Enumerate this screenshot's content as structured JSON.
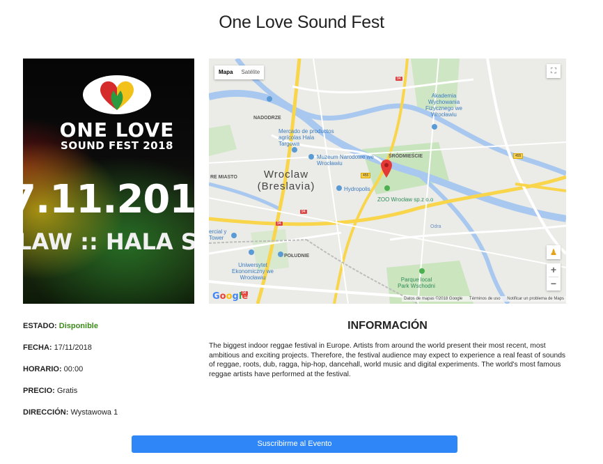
{
  "page": {
    "title": "One Love Sound Fest"
  },
  "poster": {
    "line1": "ONE LOVE",
    "line2": "SOUND FEST 2018",
    "date_fragment": "7.11.201",
    "place_fragment": "LAW :: HALA ST"
  },
  "map": {
    "type_map": "Mapa",
    "type_satellite": "Satélite",
    "labels": {
      "nadodrze": "NADODRZE",
      "mercado": "Mercado de productos agrícolas Hala Targowa",
      "muzeum": "Muzeum Narodowe we Wrocławiu",
      "akademia": "Akademia Wychowania Fizycznego we Wrocławiu",
      "srodmiescie": "ŚRÓDMIEŚCIE",
      "wroclaw": "Wroclaw (Breslavia)",
      "hydropolis": "Hydropolis",
      "zoo": "ZOO Wrocław sp.z o.o",
      "stare_miasto": "RE MIASTO",
      "tower": "ercial y Tower",
      "poludnie": "POŁUDNIE",
      "uniwersytet": "Uniwersytet Ekonomiczny we Wrocławiu",
      "parque": "Parque local Park Wschodni",
      "odra": "Odra"
    },
    "badges": [
      "455",
      "455",
      "94",
      "94",
      "94",
      "94"
    ],
    "google": "Google",
    "attribution": {
      "data": "Datos de mapas ©2018 Google",
      "terms": "Términos de uso",
      "report": "Notificar un problema de Maps"
    },
    "marker_color": "#e53935"
  },
  "details": {
    "status_label": "ESTADO:",
    "status_value": "Disponible",
    "date_label": "FECHA:",
    "date_value": "17/11/2018",
    "time_label": "HORARIO:",
    "time_value": "00:00",
    "price_label": "PRECIO:",
    "price_value": "Gratis",
    "address_label": "DIRECCIÓN:",
    "address_value": "Wystawowa 1"
  },
  "info": {
    "title": "INFORMACIÓN",
    "text": "The biggest indoor reggae festival in Europe. Artists from around the world present their most recent, most ambitious and exciting projects. Therefore, the festival audience may expect to experience a real feast of sounds of reggae, roots, dub, ragga, hip-hop, dancehall, world music and digital experiments. The world's most famous reggae artists have performed at the festival."
  },
  "actions": {
    "subscribe": "Suscribirme al Evento"
  },
  "colors": {
    "accent": "#2f86f6",
    "status": "#3d8a1c"
  }
}
